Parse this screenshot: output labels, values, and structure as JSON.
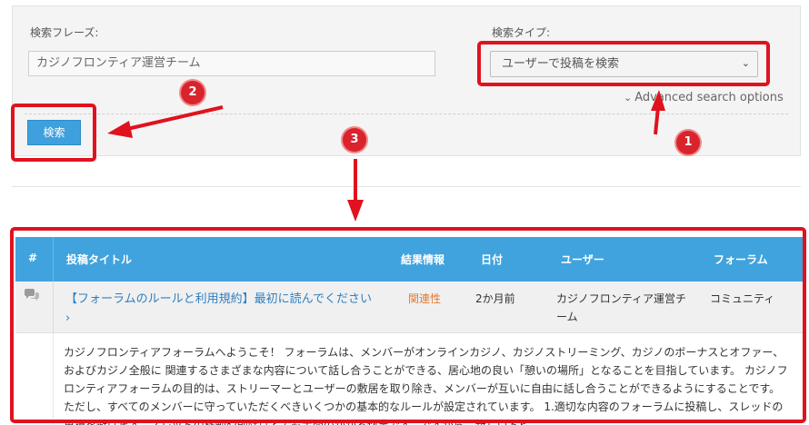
{
  "search": {
    "phrase_label": "検索フレーズ:",
    "phrase_value": "カジノフロンティア運営チーム",
    "type_label": "検索タイプ:",
    "type_value": "ユーザーで投稿を検索",
    "advanced_label": "Advanced search options",
    "submit_label": "検索"
  },
  "table": {
    "headers": [
      "#",
      "投稿タイトル",
      "結果情報",
      "日付",
      "ユーザー",
      "フォーラム"
    ],
    "rows": [
      {
        "title": "【フォーラムのルールと利用規約】最初に読んでください",
        "result_info": "関連性",
        "date": "2か月前",
        "user": "カジノフロンティア運営チーム",
        "forum": "コミュニティ",
        "excerpt": "カジノフロンティアフォーラムへようこそ！ フォーラムは、メンバーがオンラインカジノ、カジノストリーミング、カジノのボーナスとオファー、およびカジノ全般に 関連するさまざまな内容について話し合うことができる、居心地の良い「憩いの場所」となることを目指しています。 カジノフロンティアフォーラムの目的は、ストリーマーとユーザーの敷居を取り除き、メンバーが互いに自由に話し合うことができるようにすることです。 ただし、すべてのメンバーに守っていただくべきいくつかの基本的なルールが設定されています。 1.適切な内容のフォーラムに投稿し、スレッドの重複を避けます。スレッドの移動や削除はとても手間のかかる作業です。ですから、新しいトピ"
      }
    ]
  },
  "annotations": {
    "badges": [
      "1",
      "2",
      "3"
    ],
    "color": "#e0121e"
  },
  "colors": {
    "accent": "#40a3dd",
    "button": "#3ea0dd",
    "link": "#2f7fbf",
    "relevance": "#e07a2f"
  }
}
